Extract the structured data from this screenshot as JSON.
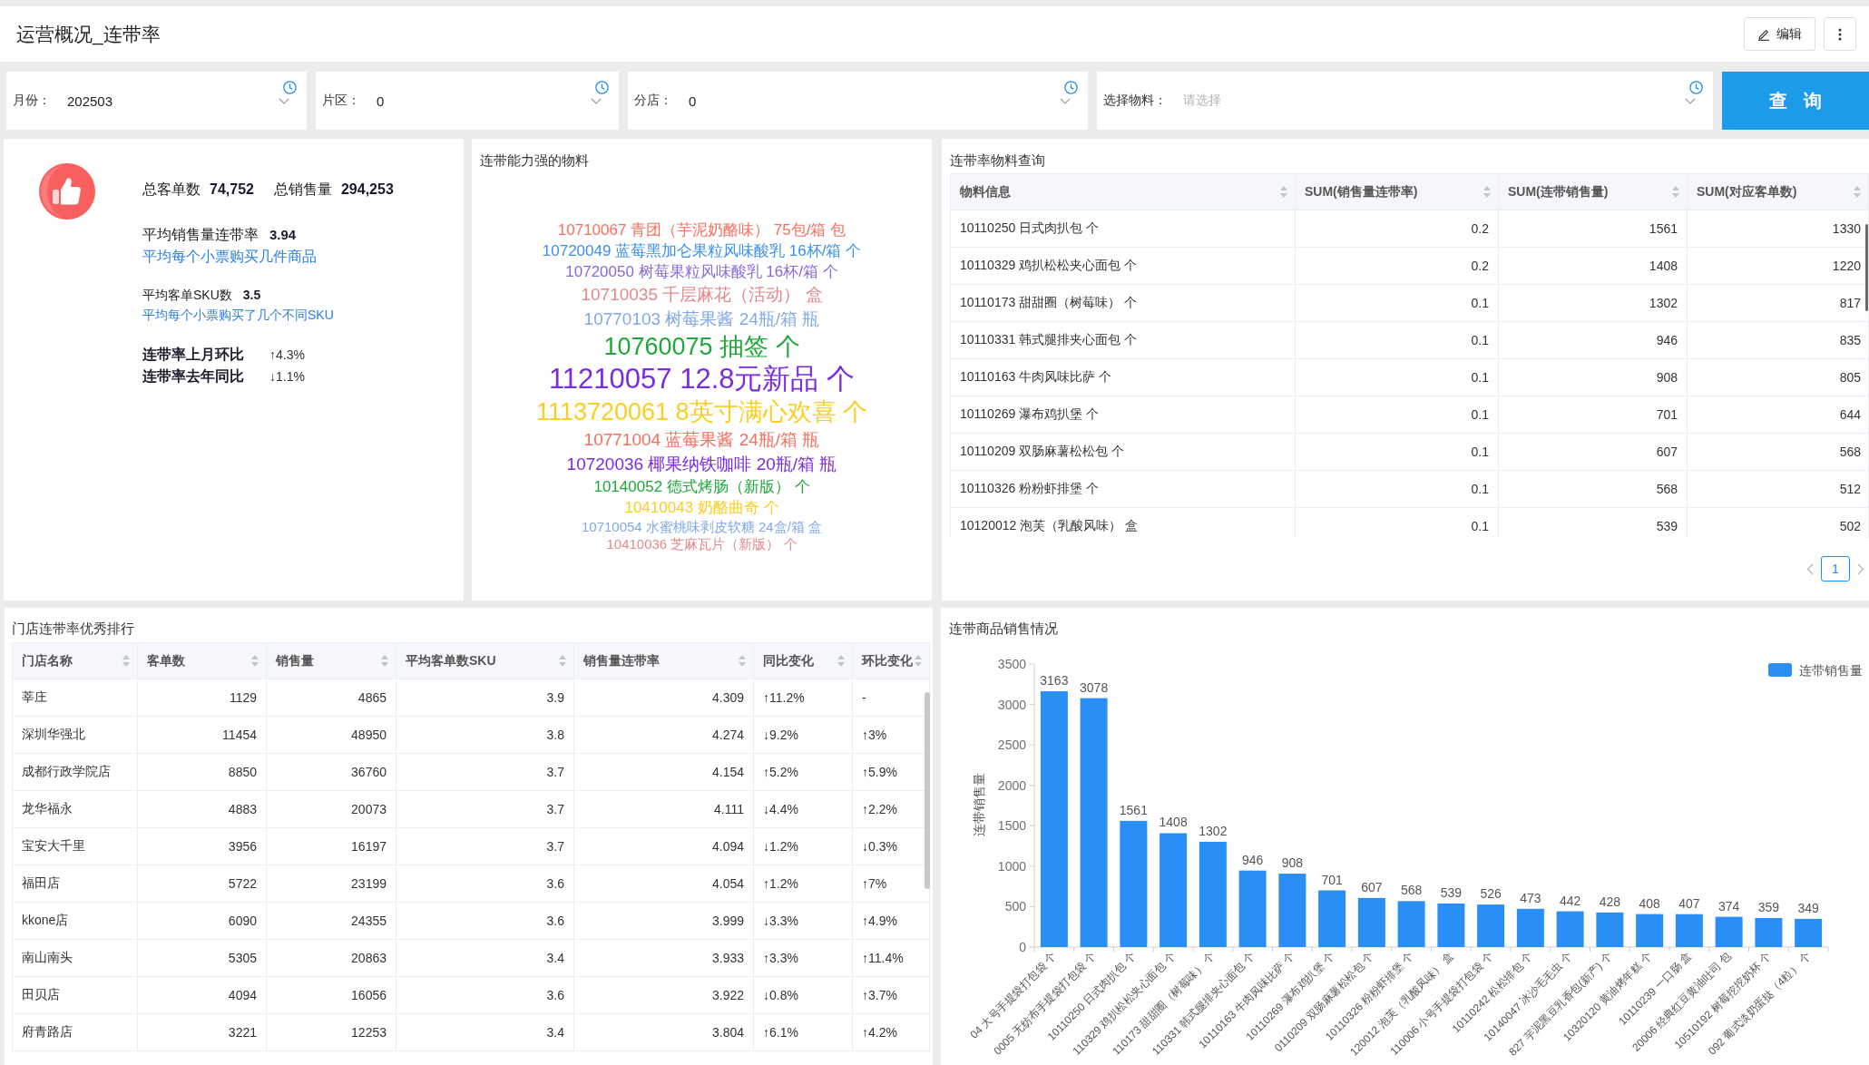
{
  "header": {
    "title": "运营概况_连带率",
    "edit_button": {
      "label": "编辑"
    }
  },
  "filters": [
    {
      "label": "月份：",
      "value": "202503"
    },
    {
      "label": "片区：",
      "value": "0"
    },
    {
      "label": "分店：",
      "value": "0"
    },
    {
      "label": "选择物料：",
      "placeholder": "请选择"
    }
  ],
  "query_button": {
    "label": "查 询"
  },
  "summary": {
    "totals": [
      {
        "label": "总客单数",
        "value": "74,752"
      },
      {
        "label": "总销售量",
        "value": "294,253"
      }
    ],
    "metrics": [
      {
        "kind": "primary",
        "label": "平均销售量连带率",
        "value": "3.94",
        "note": "平均每个小票购买几件商品"
      },
      {
        "kind": "secondary",
        "label": "平均客单SKU数",
        "value": "3.5",
        "note": "平均每个小票购买了几个不同SKU"
      }
    ],
    "changes": [
      {
        "label": "连带率上月环比",
        "value": "↑4.3%"
      },
      {
        "label": "连带率去年同比",
        "value": "↓1.1%"
      }
    ]
  },
  "word_cloud": {
    "title": "连带能力强的物料",
    "words": [
      {
        "text": "10710067 青团（芋泥奶酪味） 75包/箱 包",
        "color": "#f7705e",
        "kind": "small"
      },
      {
        "text": "10720049 蓝莓黑加仑果粒风味酸乳 16杯/箱 个",
        "color": "#3b8fef",
        "kind": "small"
      },
      {
        "text": "10720050 树莓果粒风味酸乳 16杯/箱 个",
        "color": "#8a6ad6",
        "kind": "small"
      },
      {
        "text": "10710035 千层麻花（活动） 盒",
        "color": "#e48a8a",
        "kind": "medium"
      },
      {
        "text": "10770103 树莓果酱 24瓶/箱 瓶",
        "color": "#82a9e6",
        "kind": "medium"
      },
      {
        "text": "10760075 抽签 个",
        "color": "#1fa83a",
        "kind": "large"
      },
      {
        "text": "11210057 12.8元新品 个",
        "color": "#7a2de0",
        "kind": "huge"
      },
      {
        "text": "1113720061 8英寸满心欢喜 个",
        "color": "#f8cf22",
        "kind": "large"
      },
      {
        "text": "10771004 蓝莓果酱 24瓶/箱 瓶",
        "color": "#f7705e",
        "kind": "medium"
      },
      {
        "text": "10720036 椰果纳铁咖啡 20瓶/箱 瓶",
        "color": "#7a2de0",
        "kind": "medium"
      },
      {
        "text": "10140052 德式烤肠（新版） 个",
        "color": "#1fa83a",
        "kind": "small"
      },
      {
        "text": "10410043 奶酪曲奇 个",
        "color": "#f8cf22",
        "kind": "small"
      },
      {
        "text": "10710054 水蜜桃味剥皮软糖 24盒/箱 盒",
        "color": "#82a9e6",
        "kind": "tiny"
      },
      {
        "text": "10410036 芝麻瓦片（新版） 个",
        "color": "#e48a8a",
        "kind": "tiny"
      }
    ]
  },
  "material_query": {
    "title": "连带率物料查询",
    "columns": [
      {
        "label": "物料信息",
        "kind": "text"
      },
      {
        "label": "SUM(销售量连带率)",
        "kind": "number"
      },
      {
        "label": "SUM(连带销售量)",
        "kind": "number"
      },
      {
        "label": "SUM(对应客单数)",
        "kind": "number"
      }
    ],
    "rows": [
      [
        "10110250 日式肉扒包 个",
        "0.2",
        "1561",
        "1330"
      ],
      [
        "10110329 鸡扒松松夹心面包 个",
        "0.2",
        "1408",
        "1220"
      ],
      [
        "10110173 甜甜圈（树莓味） 个",
        "0.1",
        "1302",
        "817"
      ],
      [
        "10110331 韩式腿排夹心面包 个",
        "0.1",
        "946",
        "835"
      ],
      [
        "10110163 牛肉风味比萨 个",
        "0.1",
        "908",
        "805"
      ],
      [
        "10110269 瀑布鸡扒堡 个",
        "0.1",
        "701",
        "644"
      ],
      [
        "10110209 双肠麻薯松松包 个",
        "0.1",
        "607",
        "568"
      ],
      [
        "10110326 粉粉虾排堡 个",
        "0.1",
        "568",
        "512"
      ],
      [
        "10120012 泡芙（乳酸风味） 盒",
        "0.1",
        "539",
        "502"
      ]
    ],
    "pages": [
      {
        "label": "1",
        "selected": true
      }
    ]
  },
  "store_ranking": {
    "title": "门店连带率优秀排行",
    "columns": [
      {
        "label": "门店名称",
        "kind": "text"
      },
      {
        "label": "客单数",
        "kind": "number"
      },
      {
        "label": "销售量",
        "kind": "number"
      },
      {
        "label": "平均客单数SKU",
        "kind": "number"
      },
      {
        "label": "销售量连带率",
        "kind": "number"
      },
      {
        "label": "同比变化",
        "kind": "text"
      },
      {
        "label": "环比变化",
        "kind": "text"
      }
    ],
    "rows": [
      [
        "莘庄",
        "1129",
        "4865",
        "3.9",
        "4.309",
        "↑11.2%",
        "-"
      ],
      [
        "深圳华强北",
        "11454",
        "48950",
        "3.8",
        "4.274",
        "↓9.2%",
        "↑3%"
      ],
      [
        "成都行政学院店",
        "8850",
        "36760",
        "3.7",
        "4.154",
        "↑5.2%",
        "↑5.9%"
      ],
      [
        "龙华福永",
        "4883",
        "20073",
        "3.7",
        "4.111",
        "↓4.4%",
        "↑2.2%"
      ],
      [
        "宝安大千里",
        "3956",
        "16197",
        "3.7",
        "4.094",
        "↓1.2%",
        "↓0.3%"
      ],
      [
        "福田店",
        "5722",
        "23199",
        "3.6",
        "4.054",
        "↑1.2%",
        "↑7%"
      ],
      [
        "kkone店",
        "6090",
        "24355",
        "3.6",
        "3.999",
        "↓3.3%",
        "↑4.9%"
      ],
      [
        "南山南头",
        "5305",
        "20863",
        "3.4",
        "3.933",
        "↑3.3%",
        "↑11.4%"
      ],
      [
        "田贝店",
        "4094",
        "16056",
        "3.6",
        "3.922",
        "↓0.8%",
        "↑3.7%"
      ],
      [
        "府青路店",
        "3221",
        "12253",
        "3.4",
        "3.804",
        "↑6.1%",
        "↑4.2%"
      ]
    ]
  },
  "sales_chart": {
    "title": "连带商品销售情况",
    "chart_data": {
      "type": "bar",
      "ylabel": "连带销售量",
      "categories": [
        "04 大号手提袋打包袋 个",
        "0005 无纺布手提袋打包袋 个",
        "10110250 日式肉扒包 个",
        "110329 鸡扒松松夹心面包 个",
        "110173 甜甜圈（树莓味） 个",
        "110331 韩式腿排夹心面包 个",
        "10110163 牛肉风味比萨 个",
        "10110269 瀑布鸡扒堡 个",
        "0110209 双肠麻薯松松包 个",
        "10110326 粉粉虾排堡 个",
        "120012 泡芙（乳酸风味） 盒",
        "110006 小号手提袋打包袋 个",
        "10110242 松松排包 个",
        "10140047 冰沙毛毛虫 个",
        "827 芋泥黑豆乳香包(新产) 个",
        "10320120 黄油烤年糕 个",
        "10110239 一口肠 盒",
        "20006 经典红豆黄油吐司 包",
        "10510192 树莓挖挖奶杯 个",
        "092 葡式淡奶蛋挞（4粒） 个"
      ],
      "series": [
        {
          "name": "连带销售量",
          "color": "#2a8ef7",
          "values": [
            3163,
            3078,
            1561,
            1408,
            1302,
            946,
            908,
            701,
            607,
            568,
            539,
            526,
            473,
            442,
            428,
            408,
            407,
            374,
            359,
            349
          ]
        }
      ],
      "ylim": [
        0,
        3500
      ],
      "yticks": [
        0,
        500,
        1000,
        1500,
        2000,
        2500,
        3000,
        3500
      ],
      "data_labels": true
    }
  }
}
